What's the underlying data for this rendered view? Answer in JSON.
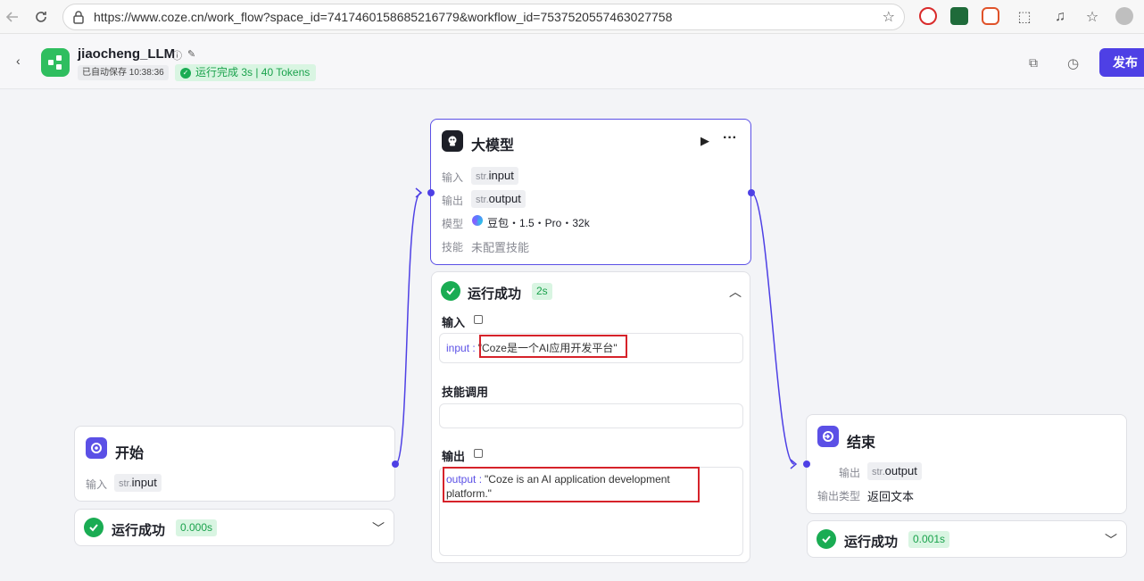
{
  "browser": {
    "url": "https://www.coze.cn/work_flow?space_id=7417460158685216779&workflow_id=7537520557463027758"
  },
  "header": {
    "title": "jiaocheng_LLM",
    "autosave": "已自动保存 10:38:36",
    "run_status": "运行完成 3s | 40 Tokens",
    "publish_label": "发布"
  },
  "llm_node": {
    "title": "大模型",
    "input_label": "输入",
    "input_type": "str.",
    "input_name": "input",
    "output_label": "输出",
    "output_type": "str.",
    "output_name": "output",
    "model_label": "模型",
    "model_value": "豆包・1.5・Pro・32k",
    "skills_label": "技能",
    "skills_value": "未配置技能"
  },
  "llm_result": {
    "status": "运行成功",
    "time": "2s",
    "input_section": "输入",
    "input_key": "input :",
    "input_value": "\"Coze是一个AI应用开发平台\"",
    "skills_section": "技能调用",
    "output_section": "输出",
    "output_key": "output :",
    "output_value_line1": "\"Coze is an AI application development",
    "output_value_line2": "platform.\""
  },
  "start_node": {
    "title": "开始",
    "input_label": "输入",
    "input_type": "str.",
    "input_name": "input",
    "status": "运行成功",
    "time": "0.000s"
  },
  "end_node": {
    "title": "结束",
    "output_label": "输出",
    "output_type": "str.",
    "output_name": "output",
    "output_type_label": "输出类型",
    "output_type_value": "返回文本",
    "status": "运行成功",
    "time": "0.001s"
  },
  "colors": {
    "accent": "#4e40e5",
    "success": "#1aac53",
    "highlight_box": "#d6222a"
  }
}
